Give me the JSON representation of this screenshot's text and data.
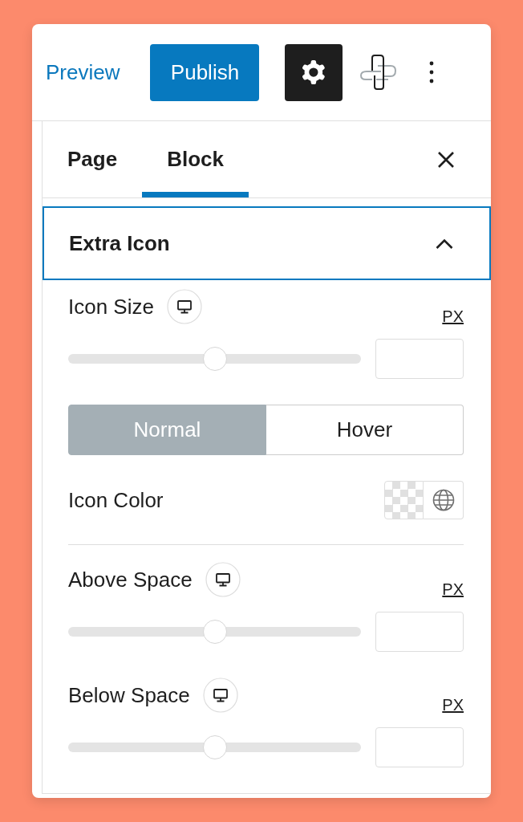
{
  "header": {
    "preview_link": "Preview",
    "publish_button": "Publish",
    "settings_toggle": {
      "pressed": true
    }
  },
  "tabs": [
    {
      "label": "Page",
      "selected": false
    },
    {
      "label": "Block",
      "selected": true
    }
  ],
  "panel": {
    "title": "Extra Icon",
    "expanded": true,
    "focused": true,
    "sections": [
      {
        "controls": [
          {
            "kind": "slider",
            "label": "Icon Size",
            "unit": "PX",
            "level": 0.5
          },
          {
            "kind": "state_toggle",
            "options": [
              {
                "label": "Normal",
                "selected": true
              },
              {
                "label": "Hover",
                "selected": false
              }
            ]
          },
          {
            "kind": "color",
            "label": "Icon Color"
          }
        ]
      },
      {
        "controls": [
          {
            "kind": "slider",
            "label": "Above Space",
            "unit": "PX",
            "level": 0.5
          },
          {
            "kind": "slider",
            "label": "Below Space",
            "unit": "PX",
            "level": 0.5
          }
        ]
      }
    ]
  }
}
